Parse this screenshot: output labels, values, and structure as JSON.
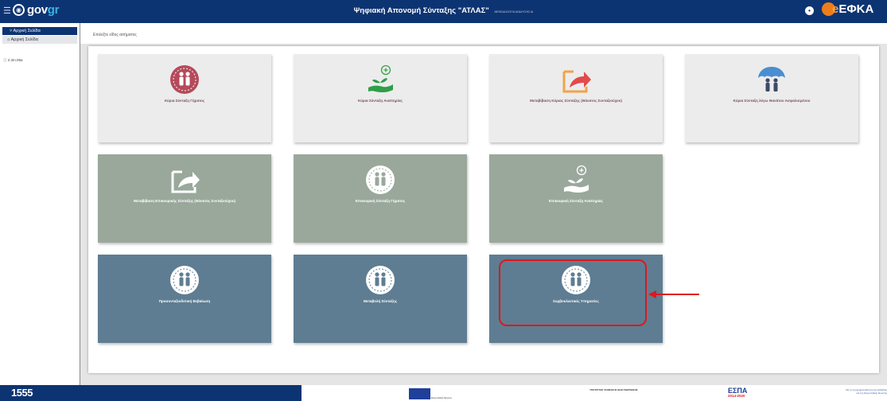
{
  "header": {
    "menu_icon": "hamburger-icon",
    "logo_prefix": "gov",
    "logo_suffix": "gr",
    "title": "Ψηφιακή Απονομή Σύνταξης \"ΑΤΛΑΣ\"",
    "title_sub": "ΜΕΘΟΔΟΛΟΓΙΑ ΑΝΑΛΥΣΗΣ ΑΙ",
    "user_icon": "user-info-icon",
    "brand_e": "e",
    "brand": "ΕΦΚΑ"
  },
  "sidebar": {
    "section_label": "Αρχική Σελίδα",
    "items": [
      {
        "label": "Αρχική Σελίδα",
        "icon": "home-icon"
      }
    ],
    "version": "2.3m.08a"
  },
  "main": {
    "breadcrumb": "Επιλέξτε είδος αιτήματος",
    "tiles": [
      {
        "label": "Κύρια Σύνταξη Γήρατος",
        "icon": "couple-icon",
        "style": "light"
      },
      {
        "label": "Κύρια Σύνταξη Αναπηρίας",
        "icon": "hand-plant-icon",
        "style": "light"
      },
      {
        "label": "Μεταβίβαση Κύριας Σύνταξης (Θάνατος Συνταξιούχου)",
        "icon": "transfer-arrow-icon",
        "style": "light"
      },
      {
        "label": "Κύρια Σύνταξη λόγω Θανάτου Ασφαλισμένου",
        "icon": "family-umbrella-icon",
        "style": "light"
      },
      {
        "label": "Μεταβίβαση Επικουρικής Σύνταξης (Θάνατος Συνταξιούχου)",
        "icon": "transfer-arrow-icon",
        "style": "green"
      },
      {
        "label": "Επικουρική Σύνταξη Γήρατος",
        "icon": "couple-icon",
        "style": "green"
      },
      {
        "label": "Επικουρική Σύνταξη Αναπηρίας",
        "icon": "hand-plant-icon",
        "style": "green"
      },
      {
        "label": "Προσυνταξιοδοτική Βεβαίωση",
        "icon": "couple-icon",
        "style": "blue"
      },
      {
        "label": "Μεταβολή Σύνταξης",
        "icon": "couple-icon",
        "style": "blue"
      },
      {
        "label": "Συμβουλευτικές Υπηρεσίες",
        "icon": "couple-icon",
        "style": "blue",
        "highlighted": true
      }
    ]
  },
  "footer": {
    "phone": "1555",
    "eu_text": "Ευρωπαϊκή Ένωση",
    "ministry_text": "ΥΠΟΥΡΓΕΙΟ ΨΗΦΙΑΚΗΣ ΔΙΑΚΥΒΕΡΝΗΣΗΣ",
    "espa": "ΕΣΠΑ",
    "espa_years": "2014-2020",
    "motto": "Με τη συγχρηματοδότηση της Ελλάδας και της Ευρωπαϊκής Ένωσης"
  },
  "colors": {
    "header_bg": "#0d3472",
    "tile_light": "#ececec",
    "tile_green": "#9aa89c",
    "tile_blue": "#5e7d92",
    "highlight": "#e0161c"
  }
}
